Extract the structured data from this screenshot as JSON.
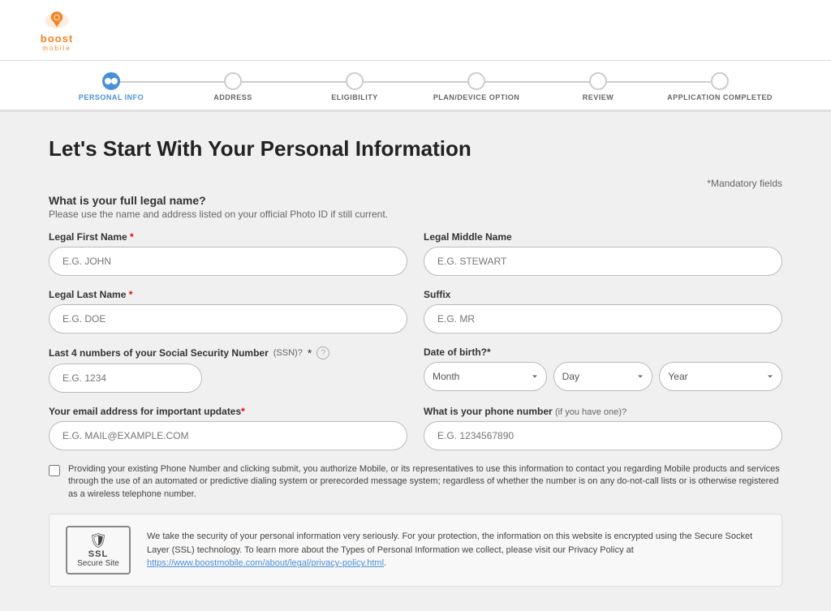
{
  "header": {
    "logo_alt": "Boost Mobile Logo",
    "logo_text": "boost",
    "logo_sub": "mobile"
  },
  "progress": {
    "steps": [
      {
        "id": "personal-info",
        "label": "PERSONAL INFO",
        "active": true
      },
      {
        "id": "address",
        "label": "ADDRESS",
        "active": false
      },
      {
        "id": "eligibility",
        "label": "ELIGIBILITY",
        "active": false
      },
      {
        "id": "plan-device",
        "label": "PLAN/DEVICE OPTION",
        "active": false
      },
      {
        "id": "review",
        "label": "REVIEW",
        "active": false
      },
      {
        "id": "completed",
        "label": "APPLICATION COMPLETED",
        "active": false
      }
    ]
  },
  "page": {
    "title": "Let's Start With Your Personal Information",
    "mandatory_note": "*Mandatory fields",
    "name_question": "What is your full legal name?",
    "name_subtitle": "Please use the name and address listed on your official Photo ID if still current.",
    "fields": {
      "legal_first_name": {
        "label": "Legal First Name",
        "required": true,
        "placeholder": "E.G. JOHN"
      },
      "legal_middle_name": {
        "label": "Legal Middle Name",
        "required": false,
        "placeholder": "E.G. STEWART"
      },
      "legal_last_name": {
        "label": "Legal Last Name",
        "required": true,
        "placeholder": "E.G. DOE"
      },
      "suffix": {
        "label": "Suffix",
        "required": false,
        "placeholder": "E.G. MR"
      },
      "ssn": {
        "label": "Last 4 numbers of your Social Security Number",
        "ssn_abbr": "(SSN)?",
        "required": true,
        "placeholder": "E.G. 1234"
      },
      "dob": {
        "label": "Date of birth?",
        "required": true,
        "month_placeholder": "Month",
        "day_placeholder": "Day",
        "year_placeholder": "Year"
      },
      "email": {
        "label": "Your email address for important updates",
        "required": true,
        "placeholder": "E.G. MAIL@EXAMPLE.COM"
      },
      "phone": {
        "label": "What is your phone number",
        "optional_text": "(if you have one)?",
        "required": false,
        "placeholder": "E.G. 1234567890"
      }
    },
    "consent_text": "Providing your existing Phone Number and clicking submit, you authorize Mobile, or its representatives to use this information to contact you regarding Mobile products and services through the use of an automated or predictive dialing system or prerecorded message system; regardless of whether the number is on any do-not-call lists or is otherwise registered as a wireless telephone number.",
    "ssl": {
      "badge_top": "SSL",
      "badge_bottom": "Secure Site",
      "text": "We take the security of your personal information very seriously. For your protection, the information on this website is encrypted using the Secure Socket Layer (SSL) technology. To learn more about the Types of Personal Information we collect, please visit our Privacy Policy at ",
      "link_text": "https://www.boostmobile.com/about/legal/privacy-policy.html",
      "link_url": "https://www.boostmobile.com/about/legal/privacy-policy.html"
    }
  }
}
